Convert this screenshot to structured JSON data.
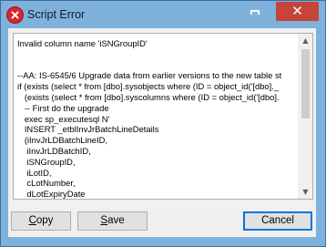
{
  "window": {
    "title": "Script Error",
    "minimize_glyph": "",
    "close_glyph": "✕",
    "title_icon": "error-icon",
    "accent": "#7eb2dd",
    "close_color": "#c7443a"
  },
  "error": {
    "lines": [
      "Invalid column name 'iSNGroupID'",
      "",
      "",
      "--AA: IS-6545/6 Upgrade data from earlier versions to the new table st",
      "if (exists (select * from [dbo].sysobjects where (ID = object_id('[dbo]._",
      "   (exists (select * from [dbo].syscolumns where (ID = object_id('[dbo].",
      "   -- First do the upgrade",
      "   exec sp_executesql N'",
      "   INSERT _etblInvJrBatchLineDetails",
      "   (iInvJrLDBatchLineID,",
      "    iInvJrLDBatchID,",
      "    iSNGroupID,",
      "    iLotID,",
      "    cLotNumber,",
      "    dLotExpiryDate"
    ]
  },
  "buttons": {
    "copy": {
      "underline": "C",
      "rest": "opy"
    },
    "save": {
      "underline": "S",
      "rest": "ave"
    },
    "cancel": "Cancel"
  }
}
